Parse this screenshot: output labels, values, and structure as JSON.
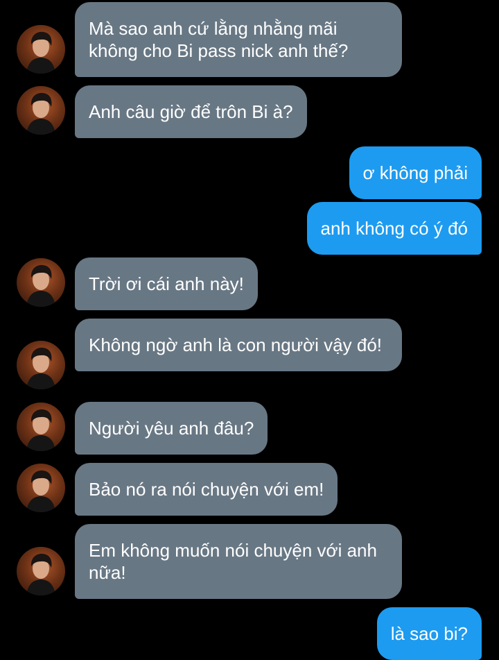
{
  "conversation": {
    "messages": [
      {
        "dir": "in",
        "text": "Mà sao anh cứ lằng nhằng mãi không cho Bi pass nick anh thế?"
      },
      {
        "dir": "in",
        "text": "Anh câu giờ để trôn Bi à?"
      },
      {
        "dir": "out",
        "text": "ơ không phải"
      },
      {
        "dir": "out",
        "text": "anh không có ý đó"
      },
      {
        "dir": "in",
        "text": "Trời ơi cái anh này!"
      },
      {
        "dir": "in",
        "text": "Không ngờ anh là con người vậy đó!"
      },
      {
        "dir": "in",
        "text": "Người yêu anh đâu?"
      },
      {
        "dir": "in",
        "text": "Bảo nó ra nói chuyện với em!"
      },
      {
        "dir": "in",
        "text": "Em không muốn nói chuyện với anh nữa!"
      },
      {
        "dir": "out",
        "text": "là sao bi?"
      }
    ]
  },
  "colors": {
    "background": "#000000",
    "incoming_bubble": "#687784",
    "outgoing_bubble": "#1d9bf0",
    "text": "#ffffff"
  },
  "icons": {
    "contact_avatar": "contact-avatar-photo"
  }
}
